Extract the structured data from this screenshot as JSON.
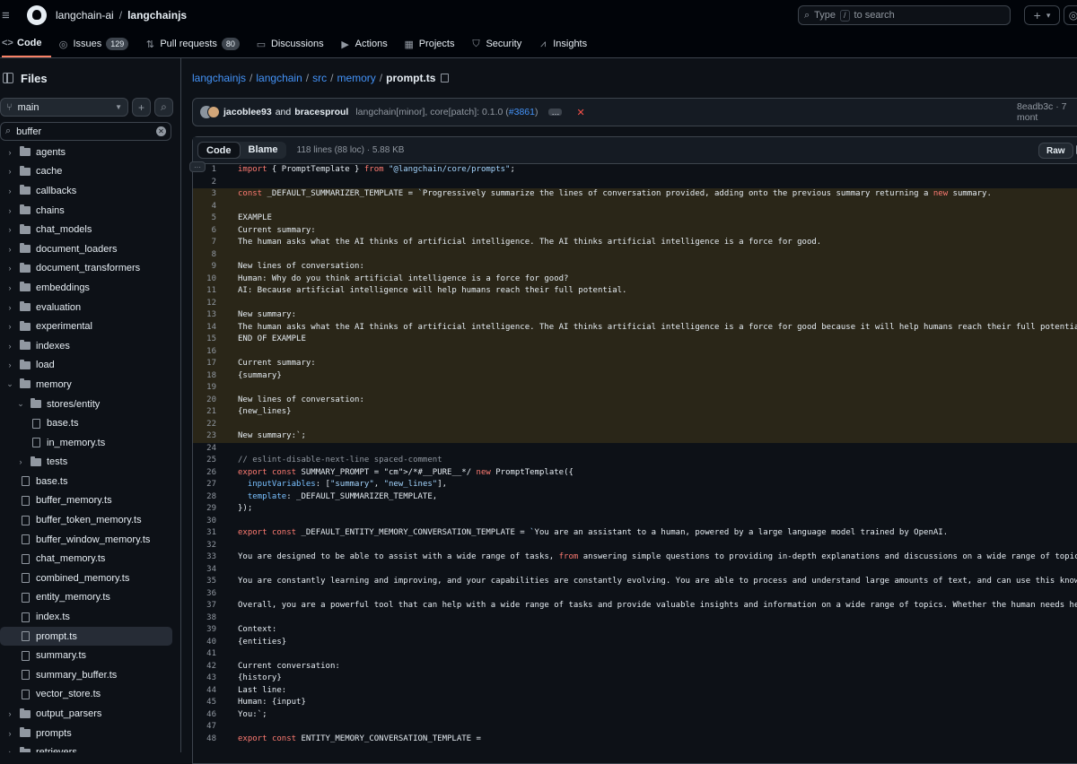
{
  "topbar": {
    "owner": "langchain-ai",
    "separator": "/",
    "repo": "langchainjs",
    "search_before": "Type",
    "search_key": "/",
    "search_after": "to search",
    "plus": "+",
    "caret": "▾"
  },
  "repo_nav": [
    {
      "label": "Code",
      "icon": "code-icon",
      "glyph": "<>",
      "active": true
    },
    {
      "label": "Issues",
      "icon": "issue-icon",
      "glyph": "◎",
      "count": "129"
    },
    {
      "label": "Pull requests",
      "icon": "pull-request-icon",
      "glyph": "⇅",
      "count": "80"
    },
    {
      "label": "Discussions",
      "icon": "discussions-icon",
      "glyph": "▭"
    },
    {
      "label": "Actions",
      "icon": "play-icon",
      "glyph": "▶"
    },
    {
      "label": "Projects",
      "icon": "table-icon",
      "glyph": "▦"
    },
    {
      "label": "Security",
      "icon": "shield-icon",
      "glyph": "⛉"
    },
    {
      "label": "Insights",
      "icon": "graph-icon",
      "glyph": "⩘"
    }
  ],
  "sidebar": {
    "title": "Files",
    "branch": "main",
    "filter_value": "buffer",
    "tree": [
      {
        "label": "agents",
        "type": "folder",
        "depth": 0
      },
      {
        "label": "cache",
        "type": "folder",
        "depth": 0
      },
      {
        "label": "callbacks",
        "type": "folder",
        "depth": 0
      },
      {
        "label": "chains",
        "type": "folder",
        "depth": 0
      },
      {
        "label": "chat_models",
        "type": "folder",
        "depth": 0
      },
      {
        "label": "document_loaders",
        "type": "folder",
        "depth": 0
      },
      {
        "label": "document_transformers",
        "type": "folder",
        "depth": 0
      },
      {
        "label": "embeddings",
        "type": "folder",
        "depth": 0
      },
      {
        "label": "evaluation",
        "type": "folder",
        "depth": 0
      },
      {
        "label": "experimental",
        "type": "folder",
        "depth": 0
      },
      {
        "label": "indexes",
        "type": "folder",
        "depth": 0
      },
      {
        "label": "load",
        "type": "folder",
        "depth": 0
      },
      {
        "label": "memory",
        "type": "folder",
        "depth": 0,
        "open": true
      },
      {
        "label": "stores/entity",
        "type": "folder",
        "depth": 1,
        "open": true
      },
      {
        "label": "base.ts",
        "type": "file",
        "depth": 2
      },
      {
        "label": "in_memory.ts",
        "type": "file",
        "depth": 2
      },
      {
        "label": "tests",
        "type": "folder",
        "depth": 1
      },
      {
        "label": "base.ts",
        "type": "file",
        "depth": 1
      },
      {
        "label": "buffer_memory.ts",
        "type": "file",
        "depth": 1
      },
      {
        "label": "buffer_token_memory.ts",
        "type": "file",
        "depth": 1
      },
      {
        "label": "buffer_window_memory.ts",
        "type": "file",
        "depth": 1
      },
      {
        "label": "chat_memory.ts",
        "type": "file",
        "depth": 1
      },
      {
        "label": "combined_memory.ts",
        "type": "file",
        "depth": 1
      },
      {
        "label": "entity_memory.ts",
        "type": "file",
        "depth": 1
      },
      {
        "label": "index.ts",
        "type": "file",
        "depth": 1
      },
      {
        "label": "prompt.ts",
        "type": "file",
        "depth": 1,
        "selected": true
      },
      {
        "label": "summary.ts",
        "type": "file",
        "depth": 1
      },
      {
        "label": "summary_buffer.ts",
        "type": "file",
        "depth": 1
      },
      {
        "label": "vector_store.ts",
        "type": "file",
        "depth": 1
      },
      {
        "label": "output_parsers",
        "type": "folder",
        "depth": 0
      },
      {
        "label": "prompts",
        "type": "folder",
        "depth": 0
      },
      {
        "label": "retrievers",
        "type": "folder",
        "depth": 0
      }
    ]
  },
  "path": {
    "segments": [
      "langchainjs",
      "langchain",
      "src",
      "memory"
    ],
    "current": "prompt.ts"
  },
  "commit": {
    "author1": "jacoblee93",
    "and": "and",
    "author2": "bracesproul",
    "message": "langchain[minor], core[patch]: 0.1.0 (",
    "pr": "#3861",
    "close_paren": ")",
    "ellipsis": "…",
    "status": "✕",
    "sha": "8eadb3c · 7 mont"
  },
  "file": {
    "tab_code": "Code",
    "tab_blame": "Blame",
    "info": "118 lines (88 loc) · 5.88 KB",
    "raw": "Raw",
    "lines": [
      {
        "n": "1",
        "t": "import { PromptTemplate } from \"@langchain/core/prompts\";"
      },
      {
        "n": "2",
        "t": ""
      },
      {
        "n": "3",
        "t": "const _DEFAULT_SUMMARIZER_TEMPLATE = `Progressively summarize the lines of conversation provided, adding onto the previous summary returning a new summary.",
        "hl": true
      },
      {
        "n": "4",
        "t": "",
        "hl": true
      },
      {
        "n": "5",
        "t": "EXAMPLE",
        "hl": true
      },
      {
        "n": "6",
        "t": "Current summary:",
        "hl": true
      },
      {
        "n": "7",
        "t": "The human asks what the AI thinks of artificial intelligence. The AI thinks artificial intelligence is a force for good.",
        "hl": true
      },
      {
        "n": "8",
        "t": "",
        "hl": true
      },
      {
        "n": "9",
        "t": "New lines of conversation:",
        "hl": true
      },
      {
        "n": "10",
        "t": "Human: Why do you think artificial intelligence is a force for good?",
        "hl": true
      },
      {
        "n": "11",
        "t": "AI: Because artificial intelligence will help humans reach their full potential.",
        "hl": true
      },
      {
        "n": "12",
        "t": "",
        "hl": true
      },
      {
        "n": "13",
        "t": "New summary:",
        "hl": true
      },
      {
        "n": "14",
        "t": "The human asks what the AI thinks of artificial intelligence. The AI thinks artificial intelligence is a force for good because it will help humans reach their full potential.",
        "hl": true
      },
      {
        "n": "15",
        "t": "END OF EXAMPLE",
        "hl": true
      },
      {
        "n": "16",
        "t": "",
        "hl": true
      },
      {
        "n": "17",
        "t": "Current summary:",
        "hl": true
      },
      {
        "n": "18",
        "t": "{summary}",
        "hl": true
      },
      {
        "n": "19",
        "t": "",
        "hl": true
      },
      {
        "n": "20",
        "t": "New lines of conversation:",
        "hl": true
      },
      {
        "n": "21",
        "t": "{new_lines}",
        "hl": true
      },
      {
        "n": "22",
        "t": "",
        "hl": true
      },
      {
        "n": "23",
        "t": "New summary:`;",
        "hl": true
      },
      {
        "n": "24",
        "t": ""
      },
      {
        "n": "25",
        "t": "// eslint-disable-next-line spaced-comment"
      },
      {
        "n": "26",
        "t": "export const SUMMARY_PROMPT = /*#__PURE__*/ new PromptTemplate({"
      },
      {
        "n": "27",
        "t": "  inputVariables: [\"summary\", \"new_lines\"],"
      },
      {
        "n": "28",
        "t": "  template: _DEFAULT_SUMMARIZER_TEMPLATE,"
      },
      {
        "n": "29",
        "t": "});"
      },
      {
        "n": "30",
        "t": ""
      },
      {
        "n": "31",
        "t": "export const _DEFAULT_ENTITY_MEMORY_CONVERSATION_TEMPLATE = `You are an assistant to a human, powered by a large language model trained by OpenAI."
      },
      {
        "n": "32",
        "t": ""
      },
      {
        "n": "33",
        "t": "You are designed to be able to assist with a wide range of tasks, from answering simple questions to providing in-depth explanations and discussions on a wide range of topics. As a language mo"
      },
      {
        "n": "34",
        "t": ""
      },
      {
        "n": "35",
        "t": "You are constantly learning and improving, and your capabilities are constantly evolving. You are able to process and understand large amounts of text, and can use this knowledge to provide ac"
      },
      {
        "n": "36",
        "t": ""
      },
      {
        "n": "37",
        "t": "Overall, you are a powerful tool that can help with a wide range of tasks and provide valuable insights and information on a wide range of topics. Whether the human needs help with a specific"
      },
      {
        "n": "38",
        "t": ""
      },
      {
        "n": "39",
        "t": "Context:"
      },
      {
        "n": "40",
        "t": "{entities}"
      },
      {
        "n": "41",
        "t": ""
      },
      {
        "n": "42",
        "t": "Current conversation:"
      },
      {
        "n": "43",
        "t": "{history}"
      },
      {
        "n": "44",
        "t": "Last line:"
      },
      {
        "n": "45",
        "t": "Human: {input}"
      },
      {
        "n": "46",
        "t": "You:`;"
      },
      {
        "n": "47",
        "t": ""
      },
      {
        "n": "48",
        "t": "export const ENTITY_MEMORY_CONVERSATION_TEMPLATE ="
      }
    ]
  },
  "colors": {
    "accent_link": "#4493f8",
    "active_tab_underline": "#f78166",
    "highlight_bg": "#2a2618",
    "status_fail": "#f85149"
  }
}
